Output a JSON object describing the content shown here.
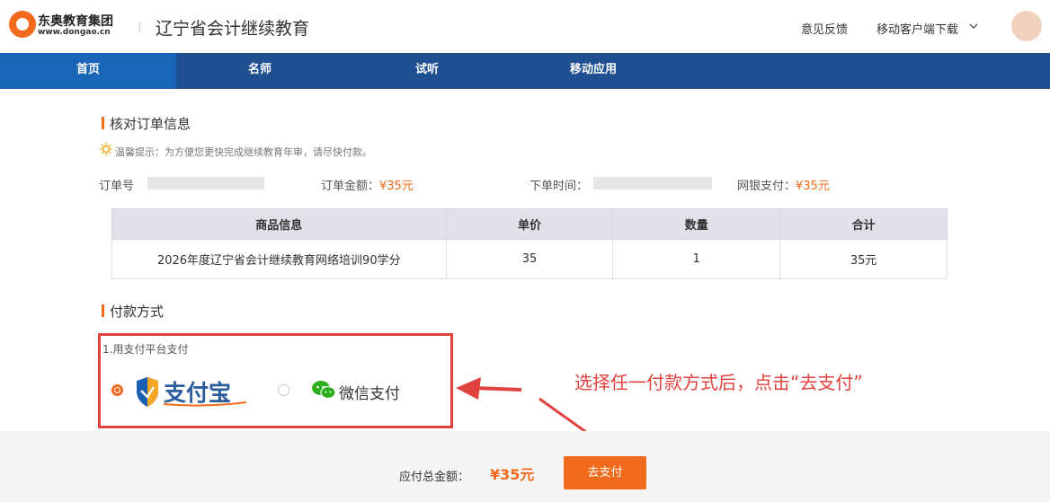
{
  "header": {
    "logo_name": "东奥教育集团",
    "logo_url": "www.dongao.cn",
    "site_title": "辽宁省会计继续教育",
    "feedback": "意见反馈",
    "mobile_download": "移动客户端下载",
    "brand_color": "#f26a1b"
  },
  "nav": {
    "items": [
      {
        "label": "首页",
        "active": true
      },
      {
        "label": "名师",
        "active": false
      },
      {
        "label": "试听",
        "active": false
      },
      {
        "label": "移动应用",
        "active": false
      }
    ],
    "color": "#1d4f91",
    "active_color": "#1a66b6"
  },
  "order": {
    "section_title": "核对订单信息",
    "tip": "温馨提示：为方便您更快完成继续教育年审，请尽快付款。",
    "order_no_label": "订单号",
    "amount_label": "订单金额：",
    "amount_value": "¥35元",
    "time_label": "下单时间：",
    "bank_label": "网银支付：",
    "bank_value": "¥35元",
    "table": {
      "headers": [
        "商品信息",
        "单价",
        "数量",
        "合计"
      ],
      "rows": [
        [
          "2026年度辽宁省会计继续教育网络培训90学分",
          "35",
          "1",
          "35元"
        ]
      ]
    }
  },
  "payment": {
    "section_title": "付款方式",
    "platform_label": "1.用支付平台支付",
    "alipay_text": "支付宝",
    "wechat_label": "微信支付",
    "selected": "alipay",
    "annotation": "选择任一付款方式后，点击“去支付”",
    "highlight_color": "#e0423e"
  },
  "footer": {
    "total_label": "应付总金额：",
    "total_value": "¥35元",
    "pay_button": "去支付"
  }
}
